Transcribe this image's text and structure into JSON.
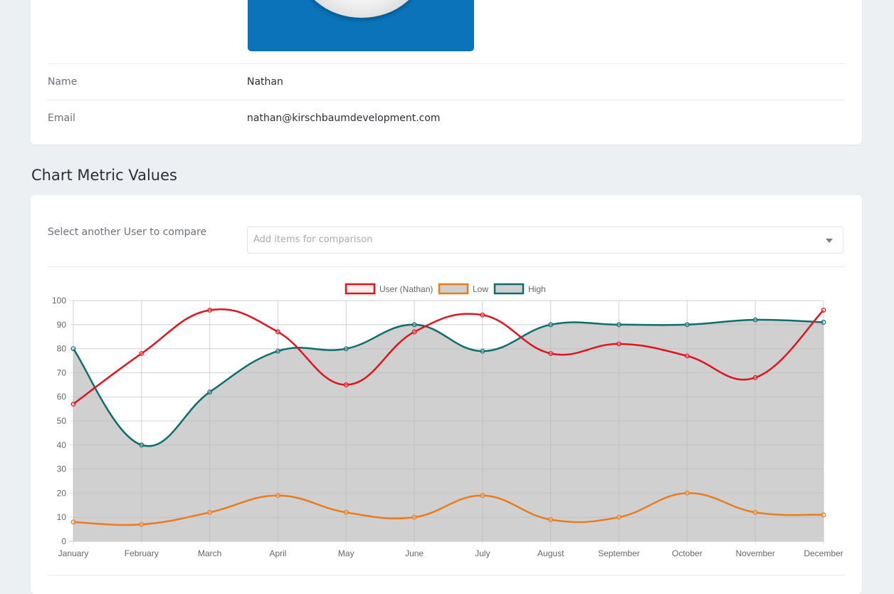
{
  "profile": {
    "name_label": "Name",
    "name_value": "Nathan",
    "email_label": "Email",
    "email_value": "nathan@kirschbaumdevelopment.com"
  },
  "section": {
    "title": "Chart Metric Values"
  },
  "compare": {
    "label": "Select another User to compare",
    "placeholder": "Add items for comparison"
  },
  "chart_data": {
    "type": "line",
    "categories": [
      "January",
      "February",
      "March",
      "April",
      "May",
      "June",
      "July",
      "August",
      "September",
      "October",
      "November",
      "December"
    ],
    "ylim": [
      0,
      100
    ],
    "yticks": [
      0,
      10,
      20,
      30,
      40,
      50,
      60,
      70,
      80,
      90,
      100
    ],
    "legend_position": "top",
    "grid": true,
    "series": [
      {
        "name": "User (Nathan)",
        "color": "#e0141e",
        "values": [
          57,
          78,
          96,
          87,
          65,
          87,
          94,
          78,
          82,
          77,
          68,
          96
        ]
      },
      {
        "name": "Low",
        "color": "#e87c1e",
        "values": [
          8,
          7,
          12,
          19,
          12,
          10,
          19,
          9,
          10,
          20,
          12,
          11
        ]
      },
      {
        "name": "High",
        "color": "#0f6d6e",
        "values": [
          80,
          40,
          62,
          79,
          80,
          90,
          79,
          90,
          90,
          90,
          92,
          91
        ],
        "fill": "#d0d0d0"
      }
    ]
  }
}
